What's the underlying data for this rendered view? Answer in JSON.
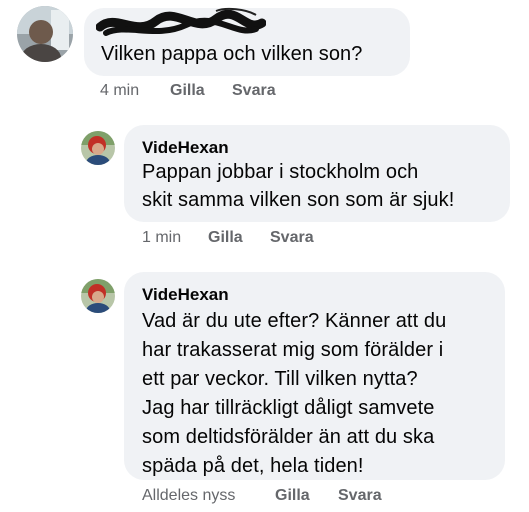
{
  "comments": [
    {
      "author": "",
      "avatar_icon": "profile-photo",
      "lines": [
        "Vilken pappa och vilken son?"
      ],
      "time": "4 min",
      "like_label": "Gilla",
      "reply_label": "Svara",
      "author_redacted": true
    },
    {
      "author": "VideHexan",
      "avatar_icon": "profile-photo",
      "lines": [
        "Pappan jobbar i stockholm och",
        "skit samma vilken son som är sjuk!"
      ],
      "time": "1 min",
      "like_label": "Gilla",
      "reply_label": "Svara"
    },
    {
      "author": "VideHexan",
      "avatar_icon": "profile-photo",
      "lines": [
        "Vad är du ute efter? Känner att du",
        "har trakasserat mig som förälder i",
        "ett par veckor. Till vilken nytta?",
        "Jag har tillräckligt dåligt samvete",
        "som deltidsförälder än att du ska",
        "späda på det, hela tiden!"
      ],
      "time": "Alldeles nyss",
      "like_label": "Gilla",
      "reply_label": "Svara"
    }
  ],
  "colors": {
    "bubble": "#f0f2f5",
    "meta_text": "#65676b",
    "body_text": "#050505"
  }
}
